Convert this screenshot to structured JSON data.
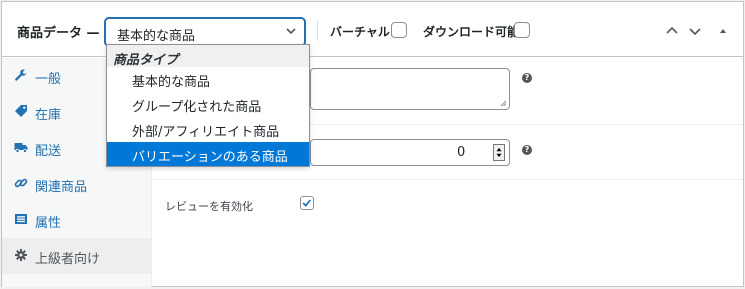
{
  "header": {
    "title": "商品データ —",
    "product_type_value": "基本的な商品",
    "virtual_label": "バーチャル:",
    "downloadable_label": "ダウンロード可能:"
  },
  "tabs": [
    {
      "label": "一般",
      "icon": "wrench-icon"
    },
    {
      "label": "在庫",
      "icon": "tag-icon"
    },
    {
      "label": "配送",
      "icon": "truck-icon"
    },
    {
      "label": "関連商品",
      "icon": "link-icon"
    },
    {
      "label": "属性",
      "icon": "list-icon"
    },
    {
      "label": "上級者向け",
      "icon": "gear-icon",
      "active": true
    }
  ],
  "content": {
    "menu_order_value": "0",
    "reviews_label": "レビューを有効化",
    "reviews_checked": true
  },
  "dropdown": {
    "group_label": "商品タイプ",
    "options": [
      {
        "label": "基本的な商品"
      },
      {
        "label": "グループ化された商品"
      },
      {
        "label": "外部/アフィリエイト商品"
      },
      {
        "label": "バリエーションのある商品",
        "highlighted": true
      }
    ]
  },
  "colors": {
    "accent": "#2271b1",
    "highlight": "#0078d7"
  }
}
